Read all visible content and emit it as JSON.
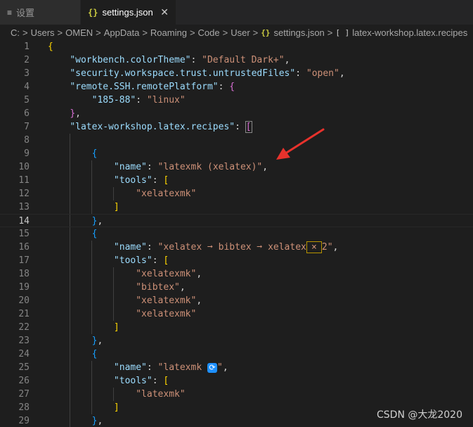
{
  "tabs": [
    {
      "label": "设置",
      "icon": "menu-icon",
      "active": false
    },
    {
      "label": "settings.json",
      "icon": "json-braces-icon",
      "active": true,
      "close": "✕"
    }
  ],
  "breadcrumb": {
    "segments": [
      "C:",
      "Users",
      "OMEN",
      "AppData",
      "Roaming",
      "Code",
      "User"
    ],
    "file": "settings.json",
    "symbol": "latex-workshop.latex.recipes",
    "file_icon_text": "{}",
    "symbol_icon_text": "[ ]",
    "separator": ">"
  },
  "editor": {
    "current_line": 14,
    "line_numbers": [
      "1",
      "2",
      "3",
      "4",
      "5",
      "6",
      "7",
      "8",
      "9",
      "10",
      "11",
      "12",
      "13",
      "14",
      "15",
      "16",
      "17",
      "18",
      "19",
      "20",
      "21",
      "22",
      "23",
      "24",
      "25",
      "26",
      "27",
      "28",
      "29"
    ],
    "keys": {
      "color_theme": "\"workbench.colorTheme\"",
      "trust": "\"security.workspace.trust.untrustedFiles\"",
      "remote": "\"remote.SSH.remotePlatform\"",
      "host": "\"185-88\"",
      "recipes": "\"latex-workshop.latex.recipes\"",
      "name": "\"name\"",
      "tools": "\"tools\""
    },
    "values": {
      "color_theme": "\"Default Dark+\"",
      "trust": "\"open\"",
      "host": "\"linux\"",
      "recipe1_name": "\"latexmk (xelatex)\"",
      "recipe1_tool": "\"xelatexmk\"",
      "recipe2_name_a": "\"xelatex ➞ bibtex ➞ xelatex",
      "recipe2_name_x": "×",
      "recipe2_name_b": "2\"",
      "recipe2_tools": [
        "\"xelatexmk\"",
        "\"bibtex\"",
        "\"xelatexmk\"",
        "\"xelatexmk\""
      ],
      "recipe3_name_a": "\"latexmk ",
      "recipe3_icon": "🔃",
      "recipe3_name_b": "\"",
      "recipe3_tool": "\"latexmk\""
    }
  },
  "watermark": "CSDN @大龙2020",
  "colors": {
    "key": "#9cdcfe",
    "string": "#ce9178",
    "bracket1": "#ffd700",
    "bracket2": "#da70d6",
    "bracket3": "#179fff",
    "arrow": "#e8322c"
  }
}
